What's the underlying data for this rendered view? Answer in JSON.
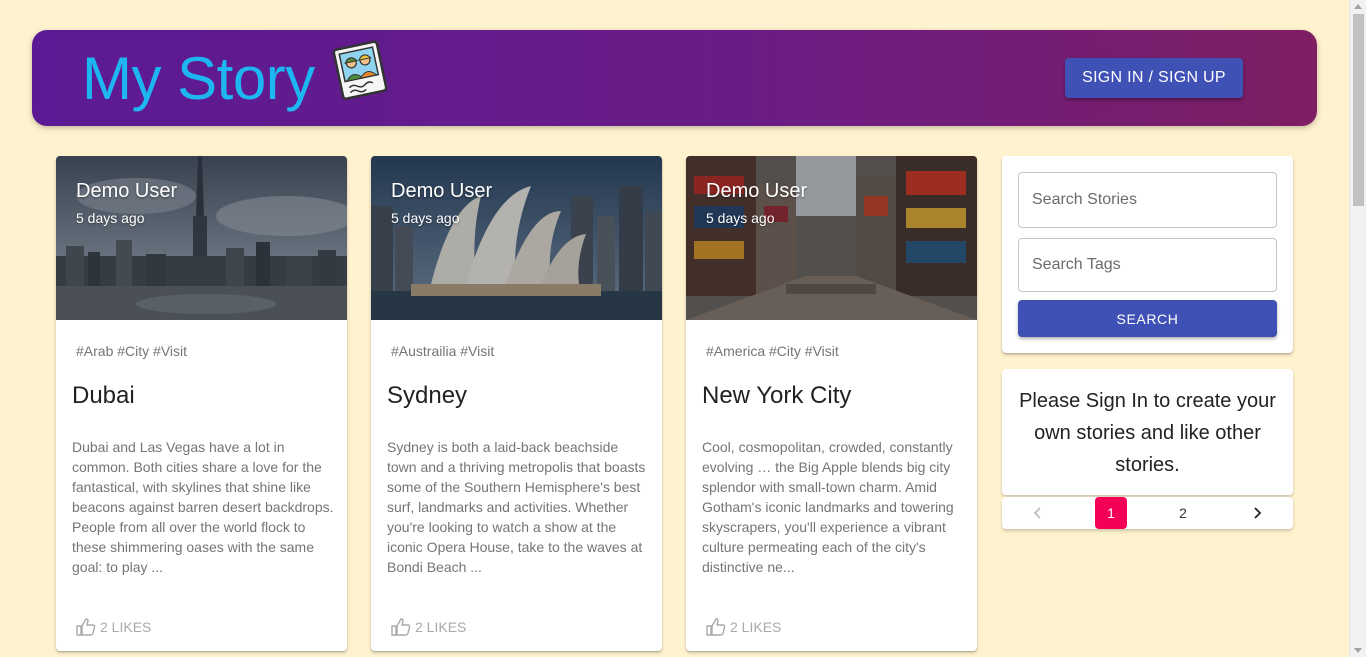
{
  "header": {
    "title": "My Story",
    "signin_label": "SIGN IN / SIGN UP"
  },
  "colors": {
    "brand_text": "#1eb6f0",
    "primary": "#3f51b5",
    "secondary": "#f50057",
    "background": "#fff3cf"
  },
  "posts": [
    {
      "author": "Demo User",
      "time": "5 days ago",
      "tags": "#Arab #City #Visit",
      "title": "Dubai",
      "description": "Dubai and Las Vegas have a lot in common. Both cities share a love for the fantastical, with skylines that shine like beacons against barren desert backdrops. People from all over the world flock to these shimmering oases with the same goal: to play ...",
      "likes": "2 LIKES",
      "image_icon": "dubai-skyline-photo"
    },
    {
      "author": "Demo User",
      "time": "5 days ago",
      "tags": "#Austrailia #Visit",
      "title": "Sydney",
      "description": "Sydney is both a laid-back beachside town and a thriving metropolis that boasts some of the Southern Hemisphere's best surf, landmarks and activities. Whether you're looking to watch a show at the iconic Opera House, take to the waves at Bondi Beach ...",
      "likes": "2 LIKES",
      "image_icon": "sydney-opera-house-photo"
    },
    {
      "author": "Demo User",
      "time": "5 days ago",
      "tags": "#America #City #Visit",
      "title": "New York City",
      "description": "Cool, cosmopolitan, crowded, constantly evolving … the Big Apple blends big city splendor with small-town charm. Amid Gotham's iconic landmarks and towering skyscrapers, you'll experience a vibrant culture permeating each of the city's distinctive ne...",
      "likes": "2 LIKES",
      "image_icon": "times-square-photo"
    }
  ],
  "search": {
    "stories_placeholder": "Search Stories",
    "tags_placeholder": "Search Tags",
    "button_label": "SEARCH"
  },
  "signin_prompt": "Please Sign In to create your own stories and like other stories.",
  "pagination": {
    "prev_icon": "chevron-left-icon",
    "pages": [
      "1",
      "2"
    ],
    "current": "1",
    "next_icon": "chevron-right-icon"
  }
}
